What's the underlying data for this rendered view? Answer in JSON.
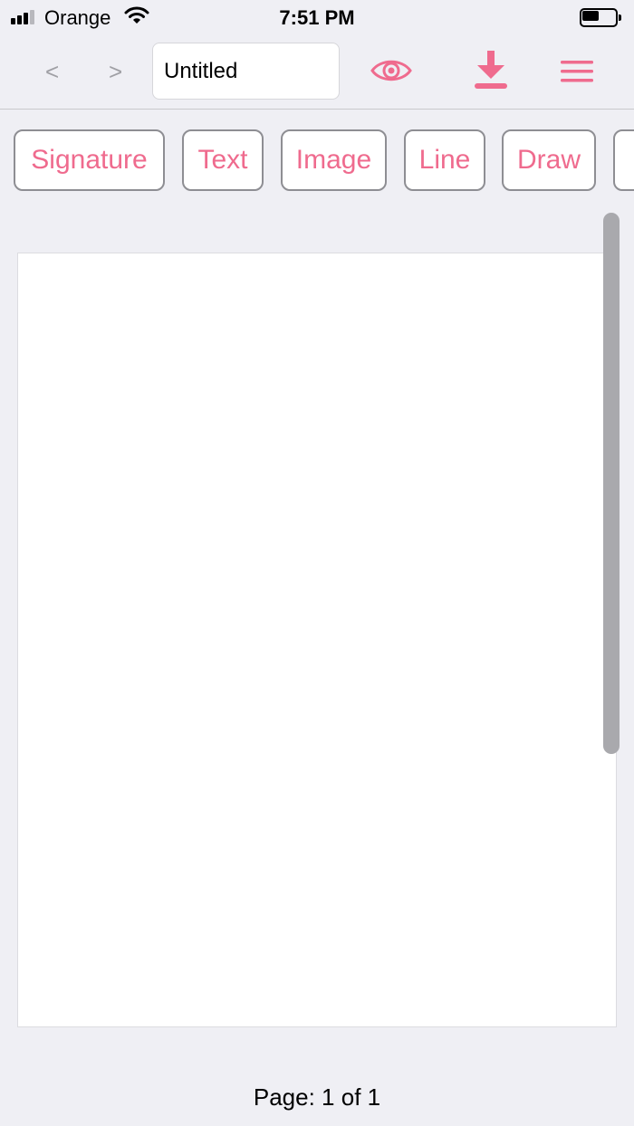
{
  "status_bar": {
    "carrier": "Orange",
    "time": "7:51 PM",
    "signal_bars_active": 3,
    "signal_bars_total": 4,
    "battery_level": 0.5
  },
  "toolbar": {
    "prev_label": "<",
    "next_label": ">",
    "title_value": "Untitled",
    "icons": [
      "eye-icon",
      "download-icon",
      "menu-icon"
    ],
    "accent_color": "#ef6b8e"
  },
  "tools": [
    {
      "label": "Signature"
    },
    {
      "label": "Text"
    },
    {
      "label": "Image"
    },
    {
      "label": "Line"
    },
    {
      "label": "Draw"
    },
    {
      "label": ""
    }
  ],
  "footer": {
    "page_indicator": "Page: 1 of 1"
  }
}
